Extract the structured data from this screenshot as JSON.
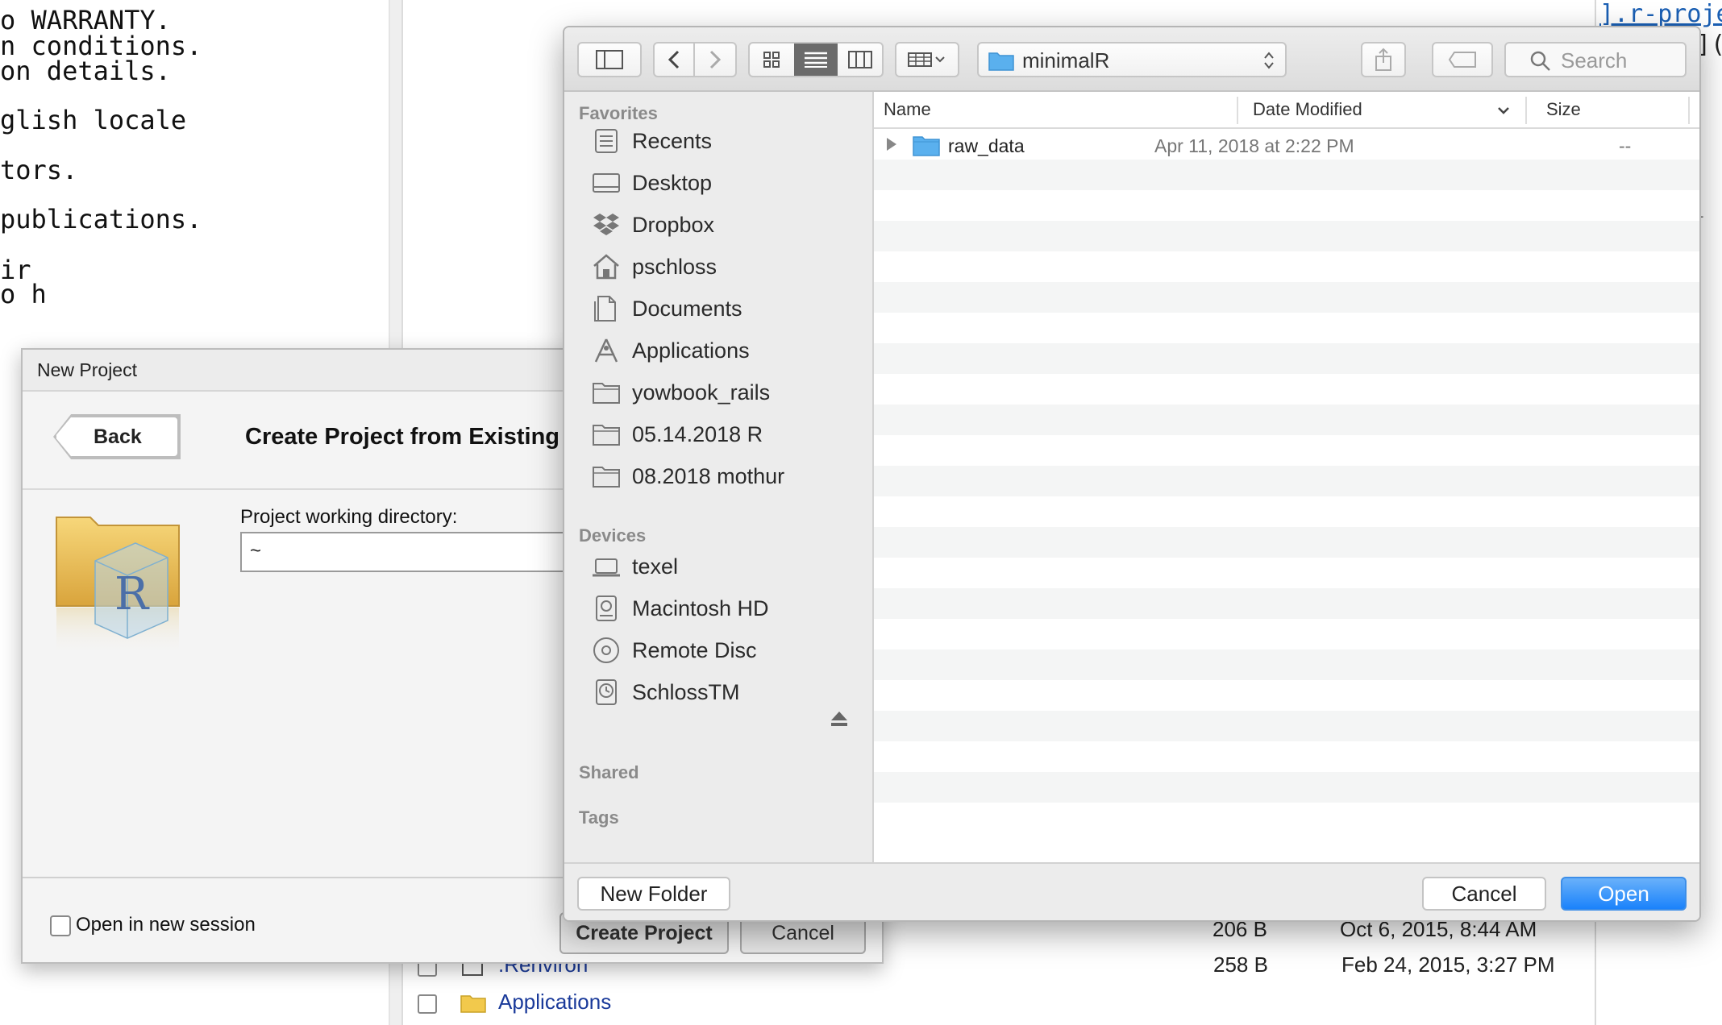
{
  "console": {
    "lines": [
      "o WARRANTY.",
      "n conditions.",
      "on details.",
      "",
      "glish locale",
      "",
      "tors.",
      "",
      "publications.",
      "",
      "ir",
      "o h"
    ]
  },
  "far_right": {
    "frag1": "].r-proje",
    "frag2": "](",
    "frag3": "--"
  },
  "files": {
    "rows": [
      {
        "name": ".Renviron",
        "size": "258 B",
        "date": "Feb 24, 2015, 3:27 PM"
      },
      {
        "name": "Applications",
        "size": "",
        "date": ""
      }
    ],
    "prev_size": "206 B",
    "prev_date": "Oct 6, 2015, 8:44 AM"
  },
  "new_project": {
    "title": "New Project",
    "back_label": "Back",
    "heading": "Create Project from Existing",
    "dir_label": "Project working directory:",
    "dir_value": "~",
    "open_new_session": "Open in new session",
    "create_label": "Create Project",
    "cancel_label": "Cancel"
  },
  "finder": {
    "path_label": "minimalR",
    "search_placeholder": "Search",
    "sections": {
      "favorites": "Favorites",
      "devices": "Devices",
      "shared": "Shared",
      "tags": "Tags"
    },
    "favorites": [
      "Recents",
      "Desktop",
      "Dropbox",
      "pschloss",
      "Documents",
      "Applications",
      "yowbook_rails",
      "05.14.2018 R",
      "08.2018 mothur"
    ],
    "devices": [
      "texel",
      "Macintosh HD",
      "Remote Disc",
      "SchlossTM"
    ],
    "columns": {
      "name": "Name",
      "date": "Date Modified",
      "size": "Size"
    },
    "rows": [
      {
        "name": "raw_data",
        "date": "Apr 11, 2018 at 2:22 PM",
        "size": "--"
      }
    ],
    "buttons": {
      "new_folder": "New Folder",
      "cancel": "Cancel",
      "open": "Open"
    },
    "colors": {
      "accent": "#1a82fb",
      "folder": "#5ab0ee"
    }
  }
}
